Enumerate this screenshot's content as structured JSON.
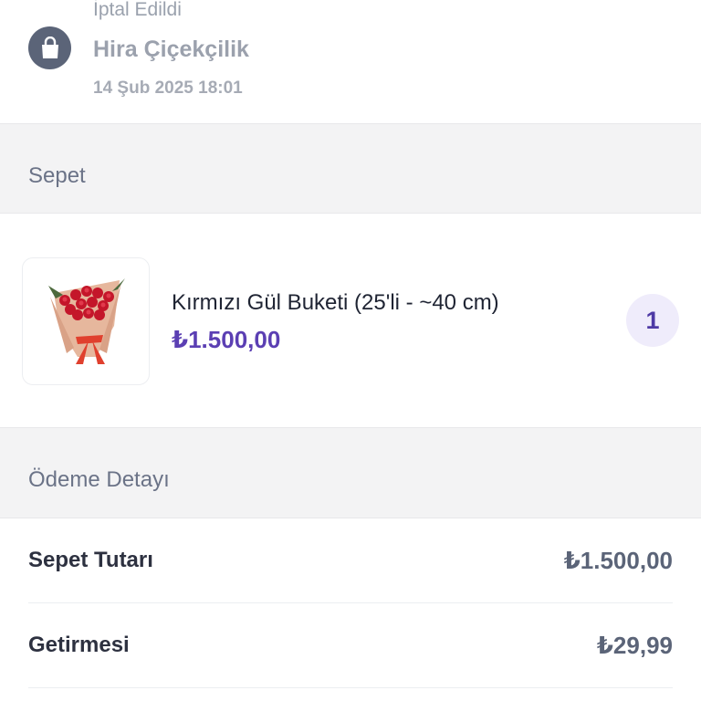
{
  "order": {
    "status": "İptal Edildi",
    "store_name": "Hira Çiçekçilik",
    "date": "14 Şub 2025 18:01",
    "store_icon": "shopping-bag-icon"
  },
  "cart": {
    "section_title": "Sepet",
    "item": {
      "name": "Kırmızı Gül Buketi (25'li - ~40 cm)",
      "price": "₺1.500,00",
      "quantity": "1"
    }
  },
  "payment": {
    "section_title": "Ödeme Detayı",
    "rows": [
      {
        "label": "Sepet Tutarı",
        "value": "₺1.500,00"
      },
      {
        "label": "Getirmesi",
        "value": "₺29,99"
      }
    ]
  },
  "colors": {
    "accent": "#5b3fb3",
    "muted": "#9aa1ad",
    "section_bg": "#f3f3f4"
  }
}
